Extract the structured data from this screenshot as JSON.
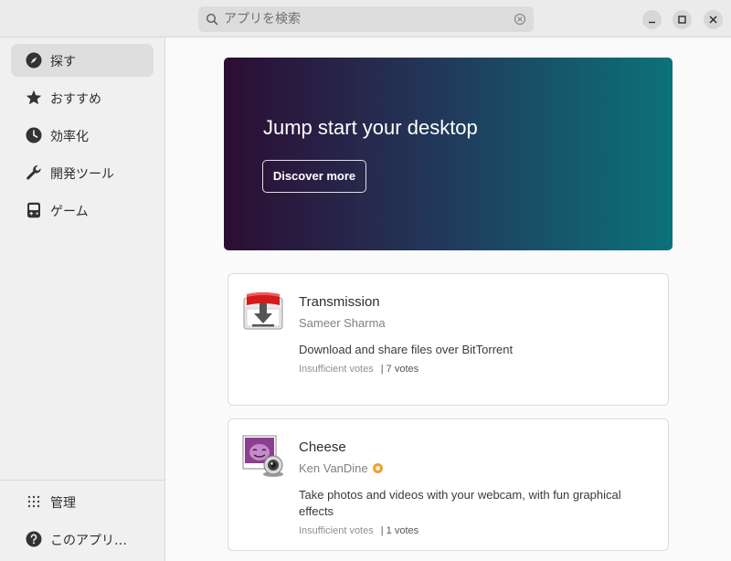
{
  "search": {
    "placeholder": "アプリを検索"
  },
  "sidebar": {
    "items": [
      {
        "label": "探す",
        "icon": "compass-icon"
      },
      {
        "label": "おすすめ",
        "icon": "star-icon"
      },
      {
        "label": "効率化",
        "icon": "clock-icon"
      },
      {
        "label": "開発ツール",
        "icon": "wrench-icon"
      },
      {
        "label": "ゲーム",
        "icon": "gamepad-icon"
      }
    ],
    "bottom": [
      {
        "label": "管理",
        "icon": "grid-icon"
      },
      {
        "label": "このアプリ…",
        "icon": "help-icon"
      }
    ]
  },
  "banner": {
    "title": "Jump start your desktop",
    "button": "Discover more"
  },
  "apps": [
    {
      "name": "Transmission",
      "developer": "Sameer Sharma",
      "summary": "Download and share files over BitTorrent",
      "rating_text": "Insufficient votes",
      "votes": "| 7 votes",
      "verified": false
    },
    {
      "name": "Cheese",
      "developer": "Ken VanDine",
      "summary": "Take photos and videos with your webcam, with fun graphical effects",
      "rating_text": "Insufficient votes",
      "votes": "| 1 votes",
      "verified": true
    }
  ],
  "colors": {
    "banner_start": "#2c0d33",
    "banner_end": "#0b727a",
    "verified_badge": "#f0a030"
  }
}
